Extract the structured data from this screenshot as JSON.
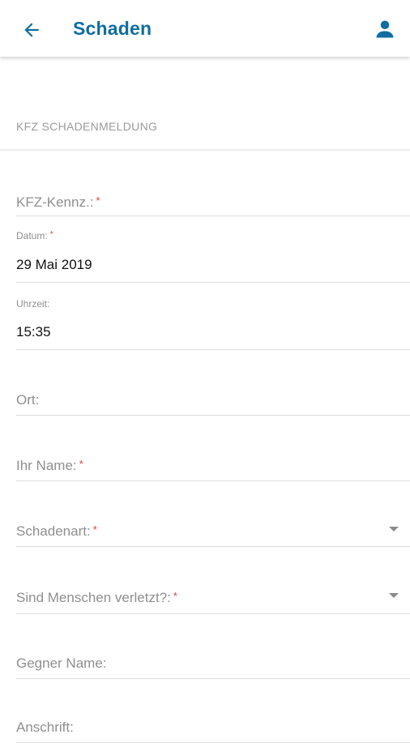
{
  "appbar": {
    "title": "Schaden",
    "back_icon": "arrow-left-icon",
    "profile_icon": "person-icon",
    "accent_color": "#0f6e9f"
  },
  "section": {
    "title": "KFZ SCHADENMELDUNG"
  },
  "form": {
    "kennz": {
      "label": "KFZ-Kennz.:",
      "required": "*"
    },
    "datum": {
      "label": "Datum:",
      "required": "*",
      "value": "29 Mai 2019"
    },
    "uhrzeit": {
      "label": "Uhrzeit:",
      "value": "15:35"
    },
    "ort": {
      "label": "Ort:"
    },
    "name": {
      "label": "Ihr Name:",
      "required": "*"
    },
    "schadenart": {
      "label": "Schadenart:",
      "required": "*"
    },
    "verletzt": {
      "label": "Sind Menschen verletzt?:",
      "required": "*"
    },
    "gegner_name": {
      "label": "Gegner Name:"
    },
    "anschrift": {
      "label": "Anschrift:"
    }
  },
  "colors": {
    "required": "#e23b3b",
    "divider": "#dcdcdc"
  }
}
